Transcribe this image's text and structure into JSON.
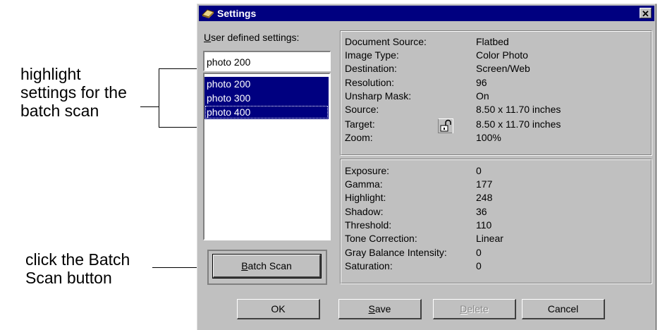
{
  "annotations": {
    "highlight": [
      "highlight",
      "settings for the",
      "batch scan"
    ],
    "click": [
      "click the Batch",
      "Scan button"
    ]
  },
  "window": {
    "title": "Settings",
    "title_icon": "scanner-icon",
    "close_icon": "close-icon",
    "close_glyph": "✕"
  },
  "left": {
    "user_label_underlined": "U",
    "user_label_rest": "ser defined settings:",
    "name_value": "photo 200",
    "list_items": [
      "photo 200",
      "photo 300",
      "photo 400"
    ],
    "batch_underlined": "B",
    "batch_rest": "atch Scan"
  },
  "info": {
    "rows": [
      {
        "label": "Document Source:",
        "value": "Flatbed"
      },
      {
        "label": "Image Type:",
        "value": "Color Photo"
      },
      {
        "label": "Destination:",
        "value": "Screen/Web"
      },
      {
        "label": "Resolution:",
        "value": "96"
      },
      {
        "label": "Unsharp Mask:",
        "value": "On"
      },
      {
        "label": "Source:",
        "value": "8.50 x 11.70 inches"
      },
      {
        "label": "Target:",
        "value": "8.50 x 11.70 inches"
      },
      {
        "label": "Zoom:",
        "value": "100%"
      }
    ],
    "lock_icon": "lock-icon"
  },
  "adjust": {
    "rows": [
      {
        "label": "Exposure:",
        "value": "0"
      },
      {
        "label": "Gamma:",
        "value": "177"
      },
      {
        "label": "Highlight:",
        "value": "248"
      },
      {
        "label": "Shadow:",
        "value": "36"
      },
      {
        "label": "Threshold:",
        "value": "110"
      },
      {
        "label": "Tone Correction:",
        "value": "Linear"
      },
      {
        "label": "Gray Balance Intensity:",
        "value": "0"
      },
      {
        "label": "Saturation:",
        "value": "0"
      }
    ]
  },
  "buttons": {
    "ok": "OK",
    "save_underlined": "S",
    "save_rest": "ave",
    "delete_underlined": "D",
    "delete_rest": "elete",
    "cancel": "Cancel"
  }
}
